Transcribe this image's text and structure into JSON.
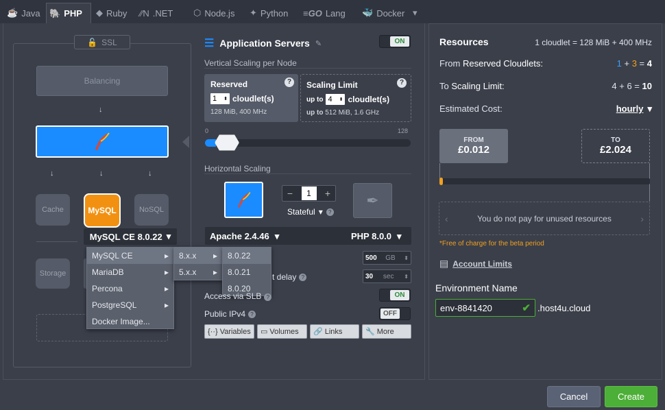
{
  "tabs": [
    {
      "label": "Java",
      "icon": "java-icon"
    },
    {
      "label": "PHP",
      "icon": "php-icon"
    },
    {
      "label": "Ruby",
      "icon": "ruby-icon"
    },
    {
      "label": ".NET",
      "icon": "dotnet-icon"
    },
    {
      "label": "Node.js",
      "icon": "nodejs-icon"
    },
    {
      "label": "Python",
      "icon": "python-icon"
    },
    {
      "label": "Lang",
      "icon": "go-icon",
      "prefix": "GO"
    },
    {
      "label": "Docker",
      "icon": "docker-icon"
    }
  ],
  "topology": {
    "ssl": "SSL",
    "balancing": "Balancing",
    "cache": "Cache",
    "nosql": "NoSQL",
    "storage": "Storage",
    "mysql_logo": "MySQL",
    "db_select": "MySQL CE 8.0.22"
  },
  "db_menu": {
    "level1": [
      "MySQL CE",
      "MariaDB",
      "Percona",
      "PostgreSQL",
      "Docker Image..."
    ],
    "level2": [
      "8.x.x",
      "5.x.x"
    ],
    "level3": [
      "8.0.22",
      "8.0.21",
      "8.0.20"
    ]
  },
  "app": {
    "title": "Application Servers",
    "on": "ON",
    "vertical_label": "Vertical Scaling per Node",
    "reserved_title": "Reserved",
    "reserved_value": "1",
    "cloudlets_word": "cloudlet(s)",
    "reserved_info": "128 MiB, 400 MHz",
    "limit_title": "Scaling Limit",
    "limit_upto": "up to",
    "limit_value": "4",
    "limit_info_prefix": "up to",
    "limit_info": "512 MiB, 1.6 GHz",
    "slider_min": "0",
    "slider_max": "128",
    "horizontal_label": "Horizontal Scaling",
    "node_count": "1",
    "stateful": "Stateful",
    "apache": "Apache 2.4.46",
    "php": "PHP 8.0.0",
    "disk_value": "500",
    "disk_unit": "GB",
    "delay_label": "t delay",
    "delay_value": "30",
    "delay_unit": "sec",
    "access_label": "Access via SLB",
    "access_state": "ON",
    "ipv4_label": "Public IPv4",
    "ipv4_state": "OFF",
    "buttons": [
      "Variables",
      "Volumes",
      "Links",
      "More"
    ]
  },
  "resources": {
    "title": "Resources",
    "cloudlet_def": "1 cloudlet = 128 MiB + 400 MHz",
    "reserved_label_from": "From",
    "reserved_label": "Reserved Cloudlets:",
    "reserved_a": "1",
    "reserved_plus": "+",
    "reserved_b": "3",
    "reserved_eq": "=",
    "reserved_total": "4",
    "limit_label_to": "To",
    "limit_label": "Scaling Limit:",
    "limit_expr": "4 + 6 =",
    "limit_total": "10",
    "cost_label": "Estimated Cost:",
    "cost_period": "hourly",
    "from_label": "FROM",
    "from_value": "£0.012",
    "to_label": "TO",
    "to_value": "£2.024",
    "unused_note": "You do not pay for unused resources",
    "beta_note": "*Free of charge for the beta period",
    "account_limits": "Account Limits",
    "env_label": "Environment Name",
    "env_value": "env-8841420",
    "env_domain": ".host4u.cloud"
  },
  "footer": {
    "cancel": "Cancel",
    "create": "Create"
  },
  "colors": {
    "accent_blue": "#1a8cff",
    "green": "#4caf37",
    "orange": "#f0a020"
  }
}
